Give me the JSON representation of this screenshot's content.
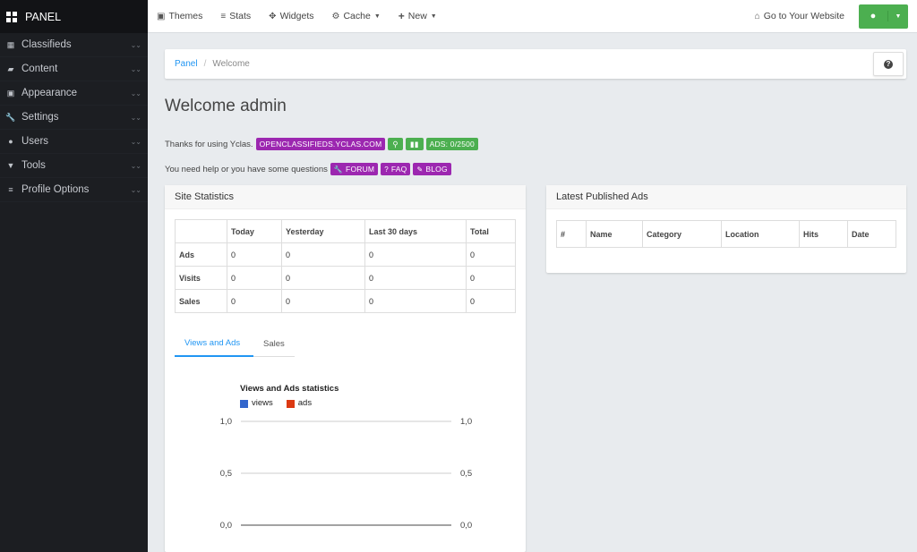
{
  "sidebar": {
    "brand": "PANEL",
    "items": [
      {
        "label": "Classifieds",
        "icon": "grid-small-icon"
      },
      {
        "label": "Content",
        "icon": "folder-open-icon"
      },
      {
        "label": "Appearance",
        "icon": "picture-icon"
      },
      {
        "label": "Settings",
        "icon": "wrench-icon"
      },
      {
        "label": "Users",
        "icon": "user-icon"
      },
      {
        "label": "Tools",
        "icon": "filter-icon"
      },
      {
        "label": "Profile Options",
        "icon": "list-icon"
      }
    ]
  },
  "topnav": {
    "themes": "Themes",
    "stats": "Stats",
    "widgets": "Widgets",
    "cache": "Cache",
    "new": "New",
    "website": "Go to Your Website"
  },
  "breadcrumb": {
    "root": "Panel",
    "current": "Welcome"
  },
  "page": {
    "title": "Welcome admin"
  },
  "thanks": {
    "text": "Thanks for using Yclas.",
    "site_badge": "OPENCLASSIFIEDS.YCLAS.COM",
    "ads_badge": "ADS: 0/2500"
  },
  "help": {
    "text": "You need help or you have some questions",
    "forum": "FORUM",
    "faq": "FAQ",
    "blog": "BLOG"
  },
  "site_stats": {
    "title": "Site Statistics",
    "columns": [
      "",
      "Today",
      "Yesterday",
      "Last 30 days",
      "Total"
    ],
    "rows": [
      {
        "label": "Ads",
        "values": [
          "0",
          "0",
          "0",
          "0"
        ]
      },
      {
        "label": "Visits",
        "values": [
          "0",
          "0",
          "0",
          "0"
        ]
      },
      {
        "label": "Sales",
        "values": [
          "0",
          "0",
          "0",
          "0"
        ]
      }
    ],
    "tabs": [
      "Views and Ads",
      "Sales"
    ]
  },
  "latest_ads": {
    "title": "Latest Published Ads",
    "columns": [
      "#",
      "Name",
      "Category",
      "Location",
      "Hits",
      "Date"
    ]
  },
  "chart_data": {
    "type": "line",
    "title": "Views and Ads statistics",
    "series": [
      {
        "name": "views",
        "color": "#3366cc",
        "values": []
      },
      {
        "name": "ads",
        "color": "#dc3912",
        "values": []
      }
    ],
    "yticks": [
      "1,0",
      "0,5",
      "0,0"
    ],
    "ylim": [
      0,
      1
    ]
  }
}
